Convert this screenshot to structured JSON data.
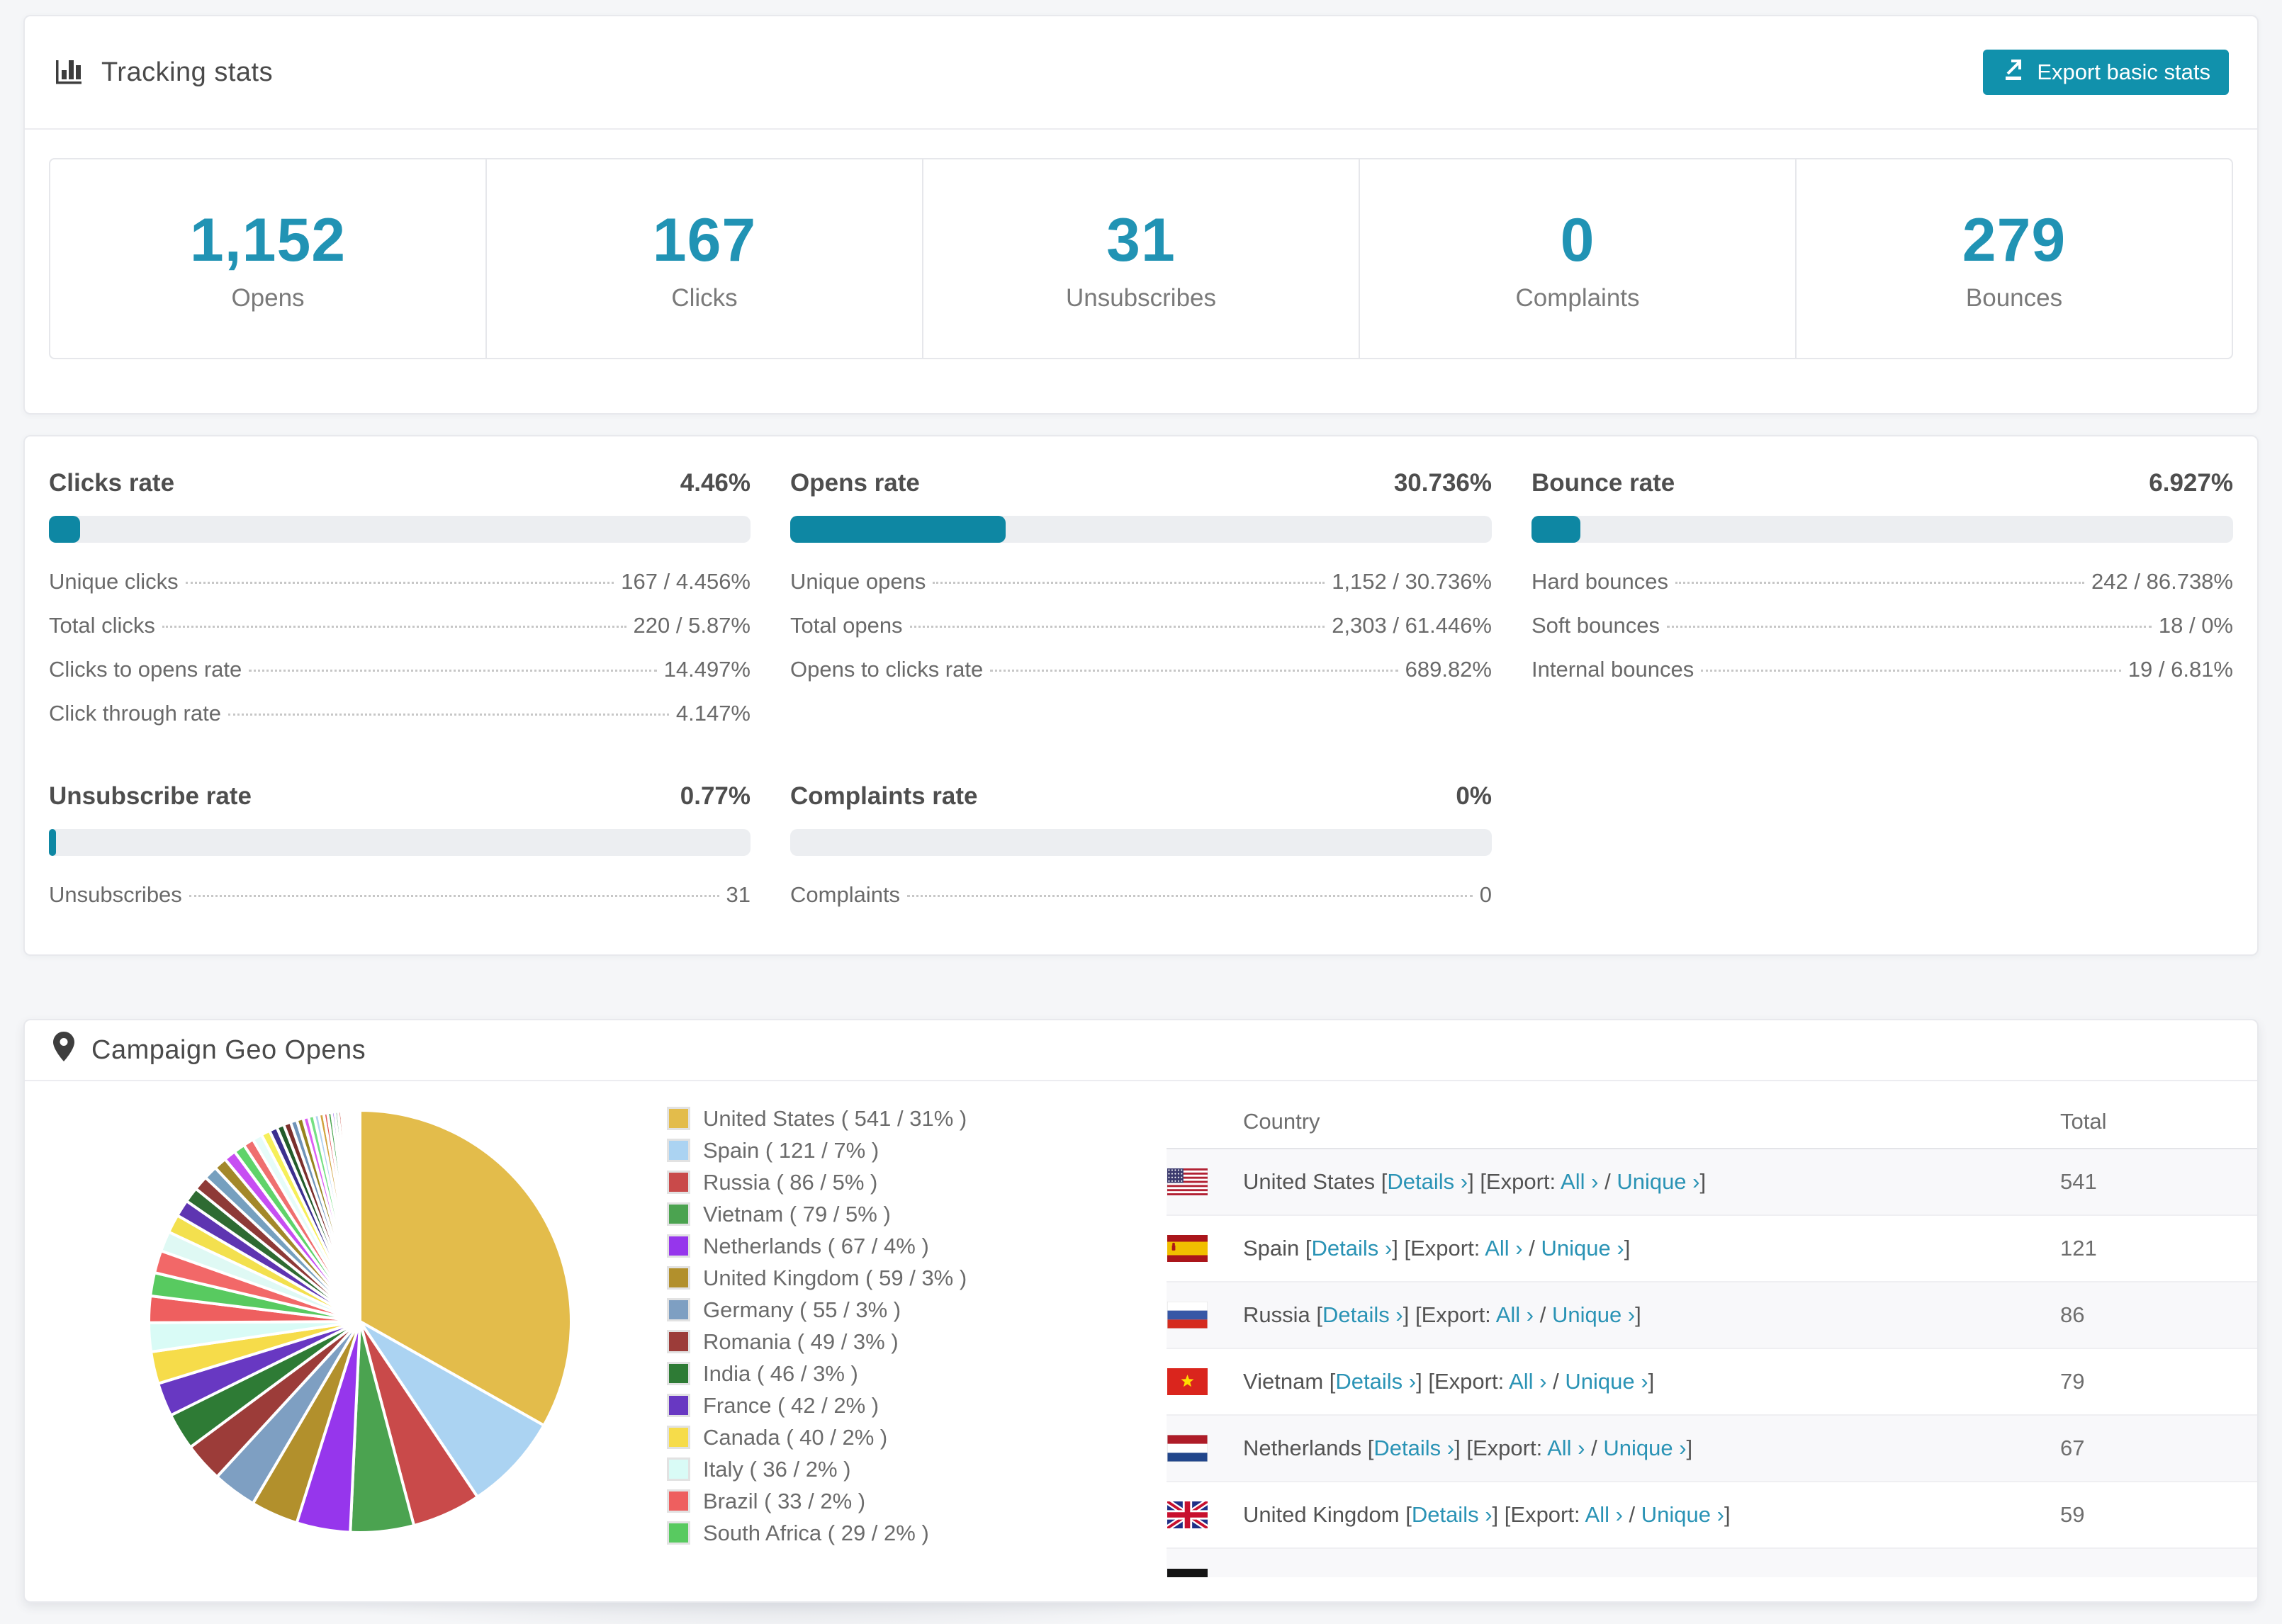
{
  "accent": {
    "teal_button": "#1191ac",
    "teal_bar": "#0e87a3",
    "teal_number": "#2193b4",
    "teal_link": "#2a93b5"
  },
  "tracking": {
    "title": "Tracking stats",
    "export_button": "Export basic stats",
    "summary_stats": [
      {
        "value": "1,152",
        "label": "Opens"
      },
      {
        "value": "167",
        "label": "Clicks"
      },
      {
        "value": "31",
        "label": "Unsubscribes"
      },
      {
        "value": "0",
        "label": "Complaints"
      },
      {
        "value": "279",
        "label": "Bounces"
      }
    ]
  },
  "rate_sections": [
    {
      "id": "clicks",
      "title": "Clicks rate",
      "value": "4.46%",
      "percent": 4.46,
      "rows": [
        [
          "Unique clicks",
          "167 / 4.456%"
        ],
        [
          "Total clicks",
          "220 / 5.87%"
        ],
        [
          "Clicks to opens rate",
          "14.497%"
        ],
        [
          "Click through rate",
          "4.147%"
        ]
      ]
    },
    {
      "id": "opens",
      "title": "Opens rate",
      "value": "30.736%",
      "percent": 30.736,
      "rows": [
        [
          "Unique opens",
          "1,152 / 30.736%"
        ],
        [
          "Total opens",
          "2,303 / 61.446%"
        ],
        [
          "Opens to clicks rate",
          "689.82%"
        ]
      ]
    },
    {
      "id": "bounce",
      "title": "Bounce rate",
      "value": "6.927%",
      "percent": 6.927,
      "rows": [
        [
          "Hard bounces",
          "242 / 86.738%"
        ],
        [
          "Soft bounces",
          "18 / 0%"
        ],
        [
          "Internal bounces",
          "19 / 6.81%"
        ]
      ]
    },
    {
      "id": "unsubscribe",
      "title": "Unsubscribe rate",
      "value": "0.77%",
      "percent": 0.77,
      "rows": [
        [
          "Unsubscribes",
          "31"
        ]
      ]
    },
    {
      "id": "complaints",
      "title": "Complaints rate",
      "value": "0%",
      "percent": 0,
      "rows": [
        [
          "Complaints",
          "0"
        ]
      ]
    }
  ],
  "geo": {
    "title": "Campaign Geo Opens",
    "legend": [
      {
        "label": "United States ( 541 / 31% )",
        "color": "#e3bc4b"
      },
      {
        "label": "Spain ( 121 / 7% )",
        "color": "#abd3f2"
      },
      {
        "label": "Russia ( 86 / 5% )",
        "color": "#c94a4a"
      },
      {
        "label": "Vietnam ( 79 / 5% )",
        "color": "#4ba350"
      },
      {
        "label": "Netherlands ( 67 / 4% )",
        "color": "#9636ec"
      },
      {
        "label": "United Kingdom ( 59 / 3% )",
        "color": "#b2902c"
      },
      {
        "label": "Germany ( 55 / 3% )",
        "color": "#7e9fc2"
      },
      {
        "label": "Romania ( 49 / 3% )",
        "color": "#9c3c39"
      },
      {
        "label": "India ( 46 / 3% )",
        "color": "#2e7b35"
      },
      {
        "label": "France ( 42 / 2% )",
        "color": "#6838c2"
      },
      {
        "label": "Canada ( 40 / 2% )",
        "color": "#f6dc4a"
      },
      {
        "label": "Italy ( 36 / 2% )",
        "color": "#d9fbf6"
      },
      {
        "label": "Brazil ( 33 / 2% )",
        "color": "#ee5f5f"
      },
      {
        "label": "South Africa ( 29 / 2% )",
        "color": "#58ca60"
      }
    ],
    "table": {
      "headers": {
        "country": "Country",
        "total": "Total"
      },
      "link_labels": {
        "details": "Details ›",
        "all": "All ›",
        "unique": "Unique ›"
      },
      "syntax": {
        "open": "[",
        "close": "]",
        "export_prefix": "[Export:",
        "slash": "/"
      },
      "rows": [
        {
          "country": "United States",
          "flag": "us",
          "total": "541"
        },
        {
          "country": "Spain",
          "flag": "es",
          "total": "121"
        },
        {
          "country": "Russia",
          "flag": "ru",
          "total": "86"
        },
        {
          "country": "Vietnam",
          "flag": "vn",
          "total": "79"
        },
        {
          "country": "Netherlands",
          "flag": "nl",
          "total": "67"
        },
        {
          "country": "United Kingdom",
          "flag": "gb",
          "total": "59"
        }
      ],
      "partial_row": {
        "flag": "de"
      }
    }
  },
  "chart_data": {
    "type": "pie",
    "title": "Campaign Geo Opens",
    "start_angle": -90,
    "direction": "clockwise",
    "legend_position": "right",
    "slices": [
      {
        "label": "United States",
        "value": 541,
        "pct": "31%",
        "color": "#e3bc4b"
      },
      {
        "label": "Spain",
        "value": 121,
        "pct": "7%",
        "color": "#abd3f2"
      },
      {
        "label": "Russia",
        "value": 86,
        "pct": "5%",
        "color": "#c94a4a"
      },
      {
        "label": "Vietnam",
        "value": 79,
        "pct": "5%",
        "color": "#4ba350"
      },
      {
        "label": "Netherlands",
        "value": 67,
        "pct": "4%",
        "color": "#9636ec"
      },
      {
        "label": "United Kingdom",
        "value": 59,
        "pct": "3%",
        "color": "#b2902c"
      },
      {
        "label": "Germany",
        "value": 55,
        "pct": "3%",
        "color": "#7e9fc2"
      },
      {
        "label": "Romania",
        "value": 49,
        "pct": "3%",
        "color": "#9c3c39"
      },
      {
        "label": "India",
        "value": 46,
        "pct": "3%",
        "color": "#2e7b35"
      },
      {
        "label": "France",
        "value": 42,
        "pct": "2%",
        "color": "#6838c2"
      },
      {
        "label": "Canada",
        "value": 40,
        "pct": "2%",
        "color": "#f6dc4a"
      },
      {
        "label": "Italy",
        "value": 36,
        "pct": "2%",
        "color": "#d9fbf6"
      },
      {
        "label": "Brazil",
        "value": 33,
        "pct": "2%",
        "color": "#ee5f5f"
      },
      {
        "label": "South Africa",
        "value": 29,
        "pct": "2%",
        "color": "#58ca60"
      }
    ],
    "tail": {
      "note": "unlabeled small countries",
      "values": [
        28,
        25,
        23,
        21,
        19,
        18,
        17,
        16,
        15,
        14,
        13,
        12,
        11,
        10,
        9,
        9,
        8,
        8,
        7,
        7,
        6,
        6,
        5,
        5,
        4,
        4,
        4,
        3,
        3,
        3,
        2,
        2,
        2,
        2,
        1,
        1,
        1,
        1,
        1,
        1
      ],
      "palette": [
        "#f26868",
        "#dff9f4",
        "#f3e04e",
        "#5e35b1",
        "#2e6b32",
        "#8e3a37",
        "#76a0bf",
        "#a3882a",
        "#c74ef2",
        "#5fd36a",
        "#ef6f6f",
        "#e6fcf9",
        "#f6ef5a",
        "#3c2f8f",
        "#235c2b",
        "#7b2f2c",
        "#6f93b8",
        "#97831f",
        "#dc5ff4",
        "#74e083",
        "#b3d3f0",
        "#d2a23d",
        "#e25858",
        "#43a24b",
        "#8247e8",
        "#31905e",
        "#c23f35",
        "#6b93f0",
        "#e9cb41",
        "#bc6cf0",
        "#71cfae",
        "#ef8660",
        "#9bbedb",
        "#cfa63b",
        "#e84f4f",
        "#55b85e",
        "#9a5ff2",
        "#3f8f6b",
        "#d97a3c",
        "#8fd0e8"
      ]
    }
  }
}
